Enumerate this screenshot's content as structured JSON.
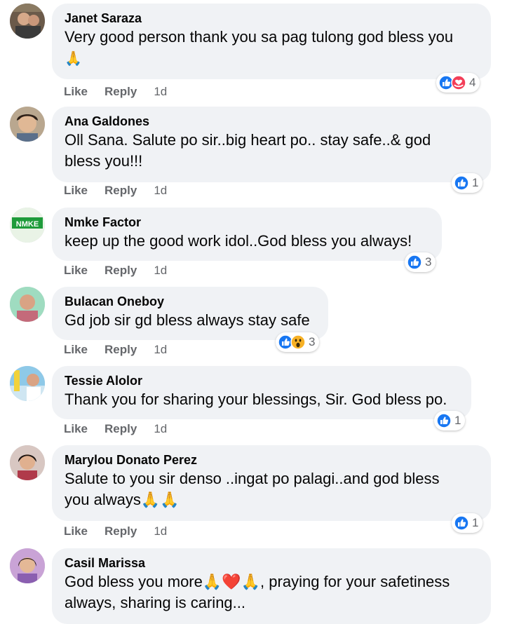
{
  "actions": {
    "like": "Like",
    "reply": "Reply"
  },
  "comments": [
    {
      "author": "Janet Saraza",
      "line1": "Very good person thank you sa pag tulong god bless you",
      "line2": "🙏",
      "time": "1d",
      "reactions": [
        "like",
        "care"
      ],
      "count": "4"
    },
    {
      "author": "Ana Galdones",
      "line1": "Oll Sana. Salute po sir..big heart po.. stay safe..& god",
      "line2": "bless you!!!",
      "time": "1d",
      "reactions": [
        "like"
      ],
      "count": "1"
    },
    {
      "author": "Nmke Factor",
      "line1": "keep up the good work idol..God bless you always!",
      "time": "1d",
      "reactions": [
        "like"
      ],
      "count": "3",
      "avatar_text": "NMKE"
    },
    {
      "author": "Bulacan Oneboy",
      "line1": "Gd job sir gd bless always stay safe",
      "time": "1d",
      "reactions": [
        "like",
        "wow"
      ],
      "count": "3"
    },
    {
      "author": "Tessie Alolor",
      "line1": "Thank you for sharing your blessings, Sir. God bless po.",
      "time": "1d",
      "reactions": [
        "like"
      ],
      "count": "1"
    },
    {
      "author": "Marylou Donato Perez",
      "line1": "Salute to you sir denso ..ingat po palagi..and god bless",
      "line2": "you always🙏🙏",
      "time": "1d",
      "reactions": [
        "like"
      ],
      "count": "1"
    },
    {
      "author": "Casil Marissa",
      "line1": "God bless you more🙏❤️🙏, praying for your safetiness",
      "line2": "always, sharing is caring..."
    }
  ]
}
